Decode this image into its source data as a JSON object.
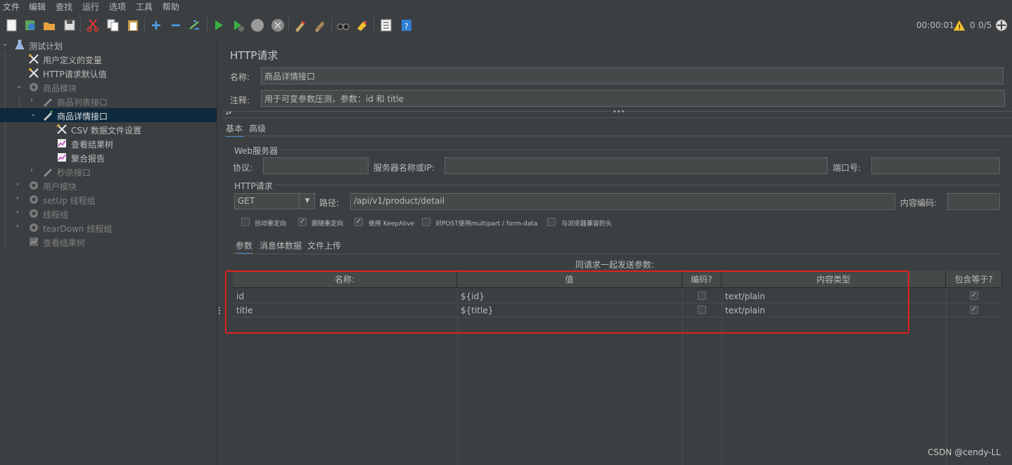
{
  "menu": [
    "文件",
    "编辑",
    "查找",
    "运行",
    "选项",
    "工具",
    "帮助"
  ],
  "status": {
    "elapsed": "00:00:01",
    "warnings": "0",
    "threads": "0/5"
  },
  "tree": [
    {
      "label": "测试计划",
      "dim": false
    },
    {
      "label": "用户定义的变量",
      "dim": false
    },
    {
      "label": "HTTP请求默认值",
      "dim": false
    },
    {
      "label": "商品模块",
      "dim": true
    },
    {
      "label": "商品列表接口",
      "dim": true
    },
    {
      "label": "商品详情接口",
      "dim": false
    },
    {
      "label": "CSV 数据文件设置",
      "dim": false
    },
    {
      "label": "查看结果树",
      "dim": false
    },
    {
      "label": "聚合报告",
      "dim": false
    },
    {
      "label": "秒杀接口",
      "dim": true
    },
    {
      "label": "用户模块",
      "dim": true
    },
    {
      "label": "setUp 线程组",
      "dim": true
    },
    {
      "label": "线程组",
      "dim": true
    },
    {
      "label": "tearDown 线程组",
      "dim": true
    },
    {
      "label": "查看结果树",
      "dim": true
    }
  ],
  "panel": {
    "title": "HTTP请求",
    "name_label": "名称:",
    "name_value": "商品详情接口",
    "comment_label": "注释:",
    "comment_value": "用于可变参数压测，参数：id 和 title",
    "tabs": [
      "基本",
      "高级"
    ],
    "web_server": {
      "legend": "Web服务器",
      "protocol_label": "协议:",
      "protocol_value": "",
      "server_label": "服务器名称或IP:",
      "server_value": "",
      "port_label": "端口号:",
      "port_value": ""
    },
    "http": {
      "legend": "HTTP请求",
      "method": "GET",
      "path_label": "路径:",
      "path_value": "/api/v1/product/detail",
      "encoding_label": "内容编码:",
      "encoding_value": ""
    },
    "options": [
      {
        "label": "自动重定向",
        "checked": false
      },
      {
        "label": "跟随重定向",
        "checked": true
      },
      {
        "label": "使用 KeepAlive",
        "checked": true
      },
      {
        "label": "对POST使用multipart / form-data",
        "checked": false
      },
      {
        "label": "与浏览器兼容的头",
        "checked": false
      }
    ],
    "subtabs": [
      "参数",
      "消息体数据",
      "文件上传"
    ],
    "params_caption": "同请求一起发送参数:",
    "columns": [
      "名称:",
      "值",
      "编码?",
      "内容类型",
      "包含等于?"
    ],
    "rows": [
      {
        "name": "id",
        "value": "${id}",
        "encode": false,
        "content_type": "text/plain",
        "include_equals": true
      },
      {
        "name": "title",
        "value": "${title}",
        "encode": false,
        "content_type": "text/plain",
        "include_equals": true
      }
    ]
  },
  "watermark": "CSDN @cendy-LL",
  "colors": {
    "background": "#3c3f41",
    "selection": "#0d293e",
    "highlight_box": "#e02020",
    "tab_underline": "#4a88c7"
  }
}
